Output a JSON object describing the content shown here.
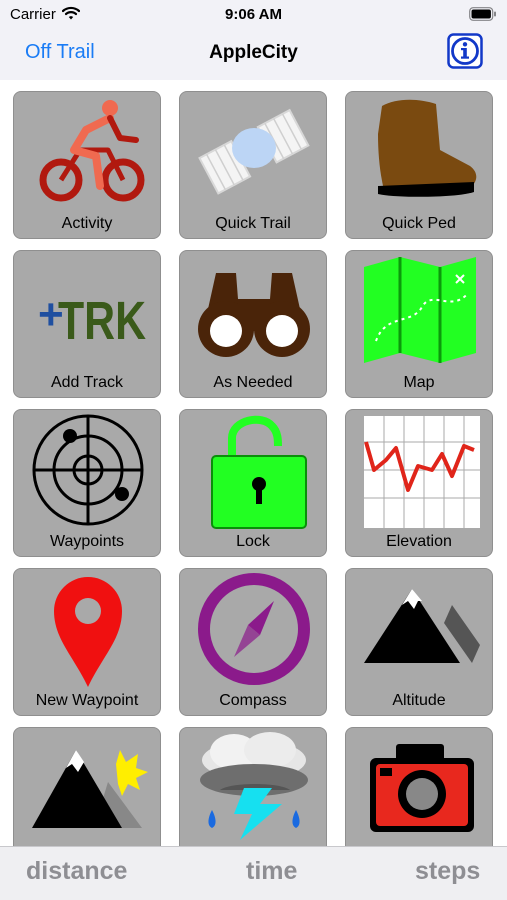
{
  "status_bar": {
    "carrier": "Carrier",
    "time": "9:06 AM"
  },
  "nav": {
    "back_label": "Off Trail",
    "title": "AppleCity"
  },
  "tiles": [
    {
      "label": "Activity",
      "icon": "bicycle-rider-icon"
    },
    {
      "label": "Quick Trail",
      "icon": "satellite-icon"
    },
    {
      "label": "Quick Ped",
      "icon": "boot-icon"
    },
    {
      "label": "Add Track",
      "icon": "add-track-icon"
    },
    {
      "label": "As Needed",
      "icon": "binoculars-icon"
    },
    {
      "label": "Map",
      "icon": "map-icon"
    },
    {
      "label": "Waypoints",
      "icon": "radar-icon"
    },
    {
      "label": "Lock",
      "icon": "unlocked-padlock-icon"
    },
    {
      "label": "Elevation",
      "icon": "elevation-graph-icon"
    },
    {
      "label": "New Waypoint",
      "icon": "map-pin-icon"
    },
    {
      "label": "Compass",
      "icon": "compass-icon"
    },
    {
      "label": "Altitude",
      "icon": "mountain-icon"
    },
    {
      "label": "",
      "icon": "mountain-sun-icon"
    },
    {
      "label": "",
      "icon": "storm-cloud-icon"
    },
    {
      "label": "",
      "icon": "camera-icon"
    }
  ],
  "track_icon_text": {
    "plus": "+",
    "letters": "TRK"
  },
  "tabs": {
    "distance": "distance",
    "time": "time",
    "steps": "steps"
  },
  "colors": {
    "accent": "#1a7cf5",
    "tile_bg": "#a9a9a9",
    "map_green": "#22ff22",
    "compass_purple": "#8b1a8b",
    "camera_red": "#e8281e"
  }
}
